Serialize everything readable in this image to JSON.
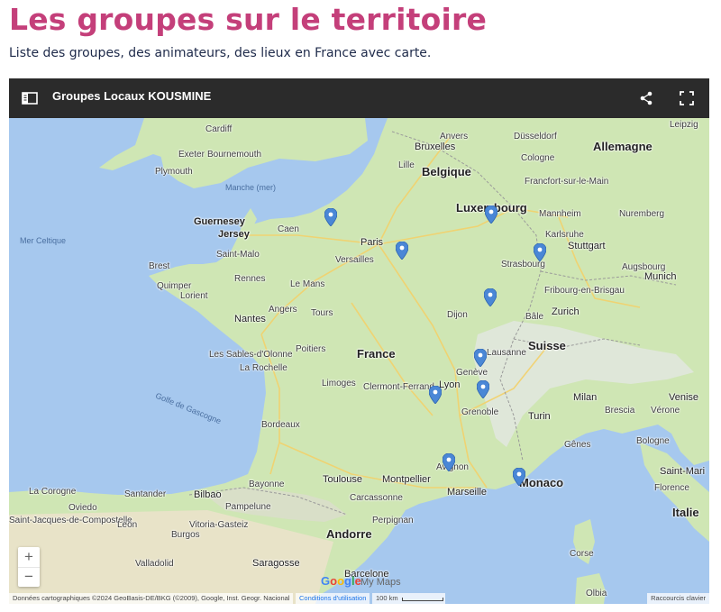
{
  "page": {
    "title": "Les groupes sur le territoire",
    "subtitle": "Liste des groupes, des animateurs, des lieux en France avec carte."
  },
  "map": {
    "header_title": "Groupes Locaux KOUSMINE",
    "icons": {
      "legend": "legend-toggle-icon",
      "share": "share-icon",
      "fullscreen": "fullscreen-icon",
      "marker": "map-pin-icon"
    },
    "colors": {
      "header_bg": "#2b2b2b",
      "water": "#a6c8ee",
      "land": "#cfe6b4",
      "marker": "#4a87d6",
      "title_accent": "#c43f7a"
    },
    "zoom": {
      "in": "+",
      "out": "−"
    },
    "attribution": "Données cartographiques ©2024 GeoBasis-DE/BKG (©2009), Google, Inst. Geogr. Nacional",
    "terms": "Conditions d'utilisation",
    "scale": "100 km",
    "shortcuts": "Raccourcis clavier",
    "logo": {
      "letters": [
        "G",
        "o",
        "o",
        "g",
        "l",
        "e"
      ],
      "suffix": "My Maps"
    },
    "labels": [
      "Leipzig",
      "Anvers",
      "Düsseldorf",
      "Cardiff",
      "Bruxelles",
      "Allemagne",
      "Exeter",
      "Bournemouth",
      "Cologne",
      "Plymouth",
      "Lille",
      "Belgique",
      "Francfort-sur-le-Main",
      "Manche (mer)",
      "Luxembourg",
      "Nuremberg",
      "Mannheim",
      "Guernesey",
      "Caen",
      "Jersey",
      "Mer Celtique",
      "Paris",
      "Karlsruhe",
      "Stuttgart",
      "Saint-Malo",
      "Versailles",
      "Strasbourg",
      "Augsbourg",
      "Brest",
      "Munich",
      "Rennes",
      "Le Mans",
      "Quimper",
      "Fribourg-en-Brisgau",
      "Lorient",
      "Zurich",
      "Angers",
      "Tours",
      "Dijon",
      "Nantes",
      "Bâle",
      "France",
      "Suisse",
      "Poitiers",
      "Les Sables-d'Olonne",
      "Lausanne",
      "La Rochelle",
      "Genève",
      "Limoges",
      "Clermont-Ferrand",
      "Lyon",
      "Milan",
      "Venise",
      "Golfe de Gascogne",
      "Grenoble",
      "Brescia",
      "Vérone",
      "Turin",
      "Bordeaux",
      "Gênes",
      "Bologne",
      "Avignon",
      "Toulouse",
      "Montpellier",
      "Marseille",
      "Monaco",
      "Saint-Mari",
      "Bayonne",
      "La Corogne",
      "Santander",
      "Bilbao",
      "Florence",
      "Oviedo",
      "Pampelune",
      "Carcassonne",
      "Saint-Jacques-de-Compostelle",
      "Vitoria-Gasteiz",
      "Italie",
      "Perpignan",
      "León",
      "Andorre",
      "Burgos",
      "Corse",
      "Valladolid",
      "Saragosse",
      "Barcelone",
      "Olbia"
    ],
    "markers": 12
  }
}
